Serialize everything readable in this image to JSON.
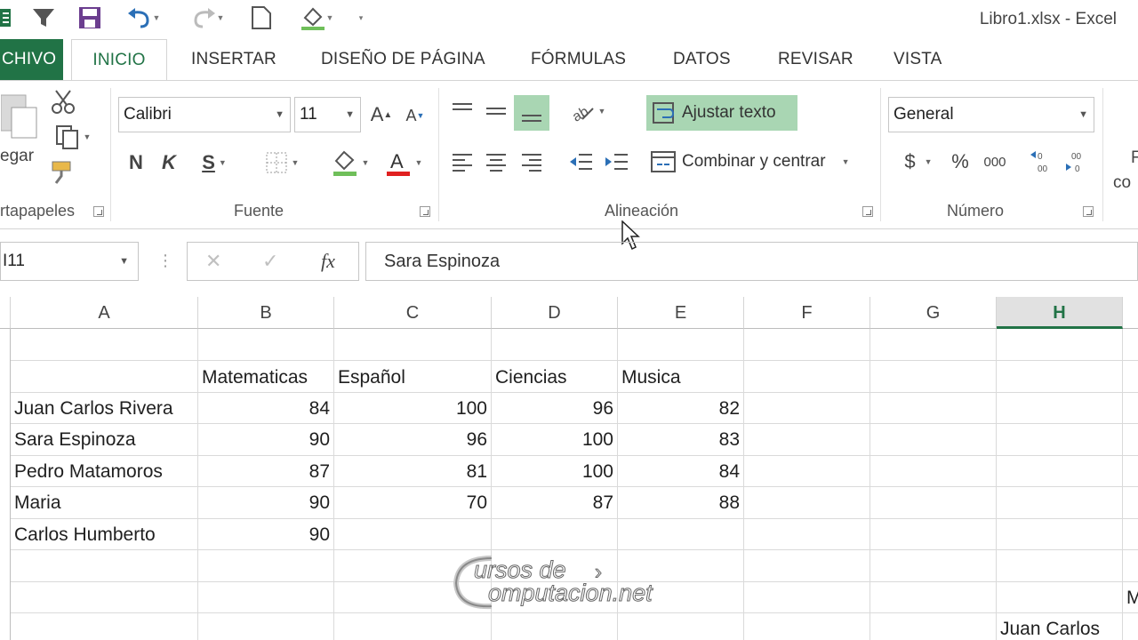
{
  "window": {
    "title": "Libro1.xlsx - Excel"
  },
  "tabs": [
    "CHIVO",
    "INICIO",
    "INSERTAR",
    "DISEÑO DE PÁGINA",
    "FÓRMULAS",
    "DATOS",
    "REVISAR",
    "VISTA"
  ],
  "ribbon": {
    "clipboard": {
      "paste_label": "egar",
      "group_label": "rtapapeles"
    },
    "font": {
      "font_name": "Calibri",
      "font_size": "11",
      "bold": "N",
      "italic": "K",
      "underline": "S",
      "group_label": "Fuente",
      "font_color": "#e02020",
      "fill_color": "#6fbf5a"
    },
    "alignment": {
      "wrap_text": "Ajustar texto",
      "merge_center": "Combinar y centrar",
      "group_label": "Alineación"
    },
    "number": {
      "format": "General",
      "currency": "$",
      "percent": "%",
      "thousands": "000",
      "group_label": "Número",
      "partial": "F",
      "partial2": "co"
    }
  },
  "formula_bar": {
    "name_box": "I11",
    "fx": "fx",
    "content": "Sara Espinoza"
  },
  "columns": [
    "A",
    "B",
    "C",
    "D",
    "E",
    "F",
    "G",
    "H"
  ],
  "selected_column": "H",
  "sheet": {
    "headers": [
      "Matematicas",
      "Español",
      "Ciencias",
      "Musica"
    ],
    "rows": [
      {
        "name": "Juan Carlos Rivera",
        "values": [
          "84",
          "100",
          "96",
          "82"
        ]
      },
      {
        "name": "Sara Espinoza",
        "values": [
          "90",
          "96",
          "100",
          "83"
        ]
      },
      {
        "name": "Pedro Matamoros",
        "values": [
          "87",
          "81",
          "100",
          "84"
        ]
      },
      {
        "name": "Maria",
        "values": [
          "90",
          "70",
          "87",
          "88"
        ]
      },
      {
        "name": "Carlos Humberto",
        "values": [
          "90",
          "",
          "",
          ""
        ]
      }
    ],
    "h_cell": "Juan Carlos",
    "i_partial": "M"
  },
  "watermark": {
    "line1": "ursos de",
    "line2": "omputacion.net"
  },
  "colors": {
    "accent": "#217346",
    "highlight": "#a9d6b3"
  }
}
